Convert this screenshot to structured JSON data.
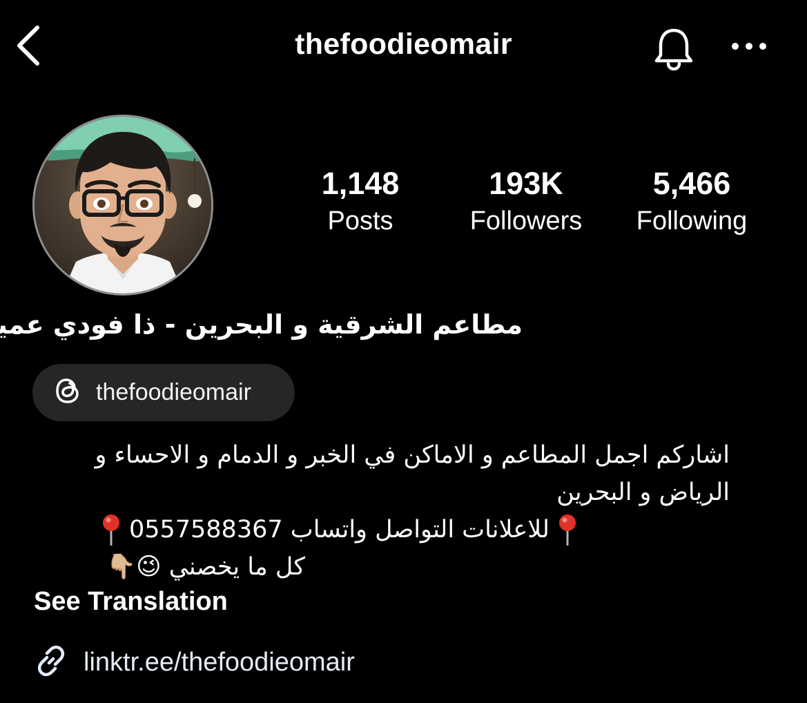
{
  "header": {
    "username": "thefoodieomair",
    "back_icon": "chevron-left-icon",
    "bell_icon": "bell-icon",
    "more_icon": "more-horizontal-icon"
  },
  "profile": {
    "avatar_icon": "bitmoji-avatar"
  },
  "stats": [
    {
      "value": "1,148",
      "label": "Posts"
    },
    {
      "value": "193K",
      "label": "Followers"
    },
    {
      "value": "5,466",
      "label": "Following"
    }
  ],
  "bio": {
    "full_name": "مطاعم الشرقية و البحرين - ذا فودي عمير",
    "threads": {
      "icon": "threads-icon",
      "handle": "thefoodieomair"
    },
    "lines": {
      "line1": "اشاركم اجمل المطاعم و الاماكن في الخبر و الدمام و الاحساء و",
      "line2": "الرياض و البحرين",
      "line3_text": "للاعلانات التواصل واتساب 0557588367",
      "line4_text": "كل ما يخصني",
      "line4_emojis": "😉👇🏼"
    },
    "see_translation": "See Translation",
    "link": {
      "icon": "link-icon",
      "url": "linktr.ee/thefoodieomair"
    }
  },
  "colors": {
    "background": "#000000",
    "text": "#ffffff",
    "pill_bg": "#262626",
    "avatar_border": "#8f8f8f"
  }
}
